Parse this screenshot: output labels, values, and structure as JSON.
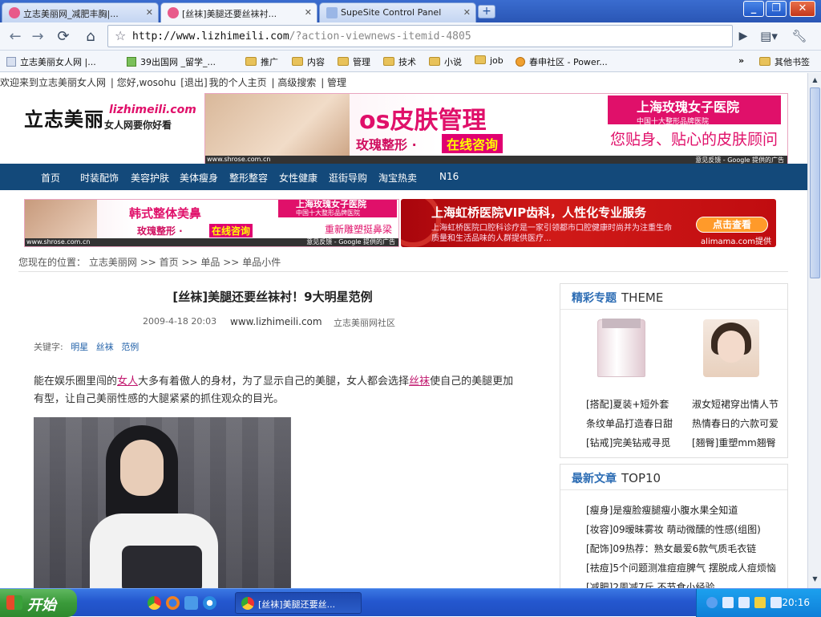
{
  "browser": {
    "tabs": [
      {
        "label": "立志美丽网_减肥丰胸|...",
        "active": false
      },
      {
        "label": "[丝袜]美腿还要丝袜衬...",
        "active": true
      },
      {
        "label": "SupeSite Control Panel",
        "active": false
      }
    ],
    "url_host": "http://www.lizhimeili.com",
    "url_path": "/?action-viewnews-itemid-4805",
    "bookmarks": [
      "立志美丽女人网 |...",
      "39出国网 _留学_...",
      "推广",
      "内容",
      "管理",
      "技术",
      "小说",
      "job",
      "春申社区 - Power...",
      "其他书签"
    ],
    "window_controls": {
      "minimize": "_",
      "maximize": "❐",
      "close": "✕"
    }
  },
  "site": {
    "topbar": {
      "welcome": "欢迎来到立志美丽女人网",
      "greeting": "您好,wosohu",
      "logout": "[退出]",
      "home": "我的个人主页",
      "search": "高级搜索",
      "admin": "管理"
    },
    "logo": {
      "cn": "立志美丽",
      "domain": "lizhimeili.com",
      "slogan": "女人网要你好看"
    },
    "banner_top": {
      "headline": "os皮肤管理",
      "line2": "玫瑰整形 ·",
      "cta": "在线咨询",
      "brand": "上海玫瑰女子医院",
      "brand_sub": "中国十大整形品牌医院",
      "tagline": "您贴身、贴心的皮肤顾问",
      "foot_url": "www.shrose.com.cn",
      "foot_right": "意见反馈 - Google 提供的广告"
    },
    "nav": [
      "首页",
      "时装配饰",
      "美容护肤",
      "美体瘦身",
      "整形整容",
      "女性健康",
      "逛街导购",
      "淘宝热卖",
      "N16"
    ],
    "ad_left": {
      "headline": "韩式整体美鼻",
      "line2": "玫瑰整形 ·",
      "cta": "在线咨询",
      "brand": "上海玫瑰女子医院",
      "brand_sub": "中国十大整形品牌医院",
      "line3": "重新雕塑挺鼻梁",
      "foot_url": "www.shrose.com.cn",
      "foot_right": "意见反馈 - Google 提供的广告"
    },
    "ad_right": {
      "headline": "上海虹桥医院VIP齿科，人性化专业服务",
      "body": "上海虹桥医院口腔科诊疗是一家引领都市口腔健康时尚并为注重生命质量和生活品味的人群提供医疗...",
      "cta": "点击查看",
      "provider": "alimama.com提供"
    },
    "breadcrumb": {
      "label": "您现在的位置：",
      "items": [
        "立志美丽网",
        "首页",
        "单品",
        "单品小件"
      ],
      "sep": ">>"
    },
    "article": {
      "title": "[丝袜]美腿还要丝袜衬！9大明星范例",
      "date": "2009-4-18 20:03",
      "site": "www.lizhimeili.com",
      "source": "立志美丽网社区",
      "keywords_label": "关键字:",
      "keywords": [
        "明星",
        "丝袜",
        "范例"
      ],
      "para_a": "能在娱乐圈里闯的",
      "para_link1": "女人",
      "para_b": "大多有着傲人的身材，为了显示自己的美腿，女人都会选择",
      "para_link2": "丝袜",
      "para_c": "使自己的美腿更加有型，让自己美丽性感的大腿紧紧的抓住观众的目光。"
    },
    "theme_panel": {
      "title": "精彩专题",
      "title_en": "THEME",
      "left_items": [
        "[搭配]夏装+短外套",
        "条纹单品打造春日甜",
        "[钻戒]完美钻戒寻觅"
      ],
      "right_items": [
        "淑女短裙穿出情人节",
        "热情春日的六款可爱",
        "[翘臀]重塑mm翘臀"
      ]
    },
    "top10_panel": {
      "title": "最新文章",
      "title_en": "TOP10",
      "items": [
        "[瘦身]是瘦脸瘦腿瘦小腹水果全知道",
        "[妆容]09暧昧雾妆 萌动微醺的性感(组图)",
        "[配饰]09热荐：熟女最爱6款气质毛衣链",
        "[祛痘]5个问题测准痘痘脾气 摆脱成人痘烦恼",
        "[减肥]2周减7斤 不节食小经验"
      ]
    }
  },
  "taskbar": {
    "start_label": "开始",
    "task_label": "[丝袜]美腿还要丝...",
    "clock": "20:16"
  }
}
